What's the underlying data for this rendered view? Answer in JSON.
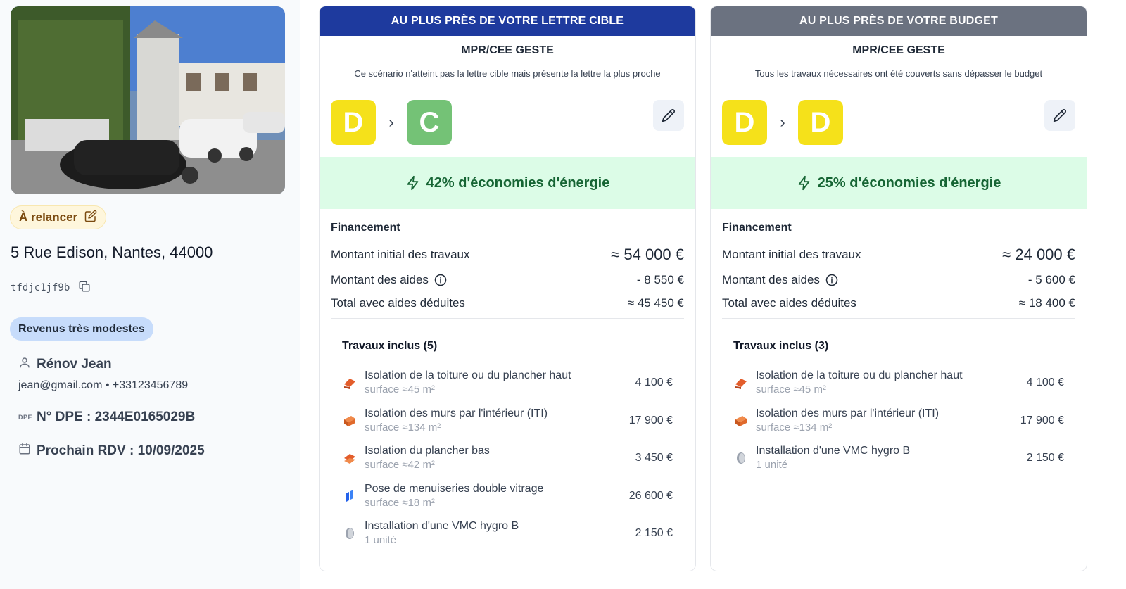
{
  "sidebar": {
    "status_label": "À relancer",
    "address": "5 Rue Edison, Nantes, 44000",
    "reference": "tfdjc1jf9b",
    "income_badge": "Revenus très modestes",
    "person_name": "Rénov Jean",
    "contact": "jean@gmail.com • +33123456789",
    "dpe_mini": "DPE",
    "dpe_label": "N° DPE : 2344E0165029B",
    "rdv_label": "Prochain RDV : 10/09/2025"
  },
  "colors": {
    "card1_header": "#1e3a9e",
    "card2_header": "#6b7280",
    "grade_D": "#f5e11a",
    "grade_C": "#74c276",
    "savings_bg": "#dcfce7",
    "savings_text": "#166534"
  },
  "cards": [
    {
      "header": "AU PLUS PRÈS DE VOTRE LETTRE CIBLE",
      "subtitle": "MPR/CEE GESTE",
      "description": "Ce scénario n'atteint pas la lettre cible mais présente la lettre la plus proche",
      "grade_from": "D",
      "grade_to": "C",
      "savings": "42% d'économies d'énergie",
      "financing_title": "Financement",
      "initial_label": "Montant initial des travaux",
      "initial_value": "≈ 54 000 €",
      "aid_label": "Montant des aides",
      "aid_value": "- 8 550 €",
      "total_label": "Total avec aides déduites",
      "total_value": "≈ 45 450 €",
      "works_title": "Travaux inclus (5)",
      "works": [
        {
          "icon": "roof-insulation-icon",
          "name": "Isolation de la toiture ou du plancher haut",
          "sub": "surface ≈45 m²",
          "price": "4 100 €"
        },
        {
          "icon": "wall-insulation-icon",
          "name": "Isolation des murs par l'intérieur (ITI)",
          "sub": "surface ≈134 m²",
          "price": "17 900 €"
        },
        {
          "icon": "floor-insulation-icon",
          "name": "Isolation du plancher bas",
          "sub": "surface ≈42 m²",
          "price": "3 450 €"
        },
        {
          "icon": "window-icon",
          "name": "Pose de menuiseries double vitrage",
          "sub": "surface ≈18 m²",
          "price": "26 600 €"
        },
        {
          "icon": "vmc-icon",
          "name": "Installation d'une VMC hygro B",
          "sub": "1 unité",
          "price": "2 150 €"
        }
      ]
    },
    {
      "header": "AU PLUS PRÈS DE VOTRE BUDGET",
      "subtitle": "MPR/CEE GESTE",
      "description": "Tous les travaux nécessaires ont été couverts sans dépasser le budget",
      "grade_from": "D",
      "grade_to": "D",
      "savings": "25% d'économies d'énergie",
      "financing_title": "Financement",
      "initial_label": "Montant initial des travaux",
      "initial_value": "≈ 24 000 €",
      "aid_label": "Montant des aides",
      "aid_value": "- 5 600 €",
      "total_label": "Total avec aides déduites",
      "total_value": "≈ 18 400 €",
      "works_title": "Travaux inclus (3)",
      "works": [
        {
          "icon": "roof-insulation-icon",
          "name": "Isolation de la toiture ou du plancher haut",
          "sub": "surface ≈45 m²",
          "price": "4 100 €"
        },
        {
          "icon": "wall-insulation-icon",
          "name": "Isolation des murs par l'intérieur (ITI)",
          "sub": "surface ≈134 m²",
          "price": "17 900 €"
        },
        {
          "icon": "vmc-icon",
          "name": "Installation d'une VMC hygro B",
          "sub": "1 unité",
          "price": "2 150 €"
        }
      ]
    }
  ]
}
